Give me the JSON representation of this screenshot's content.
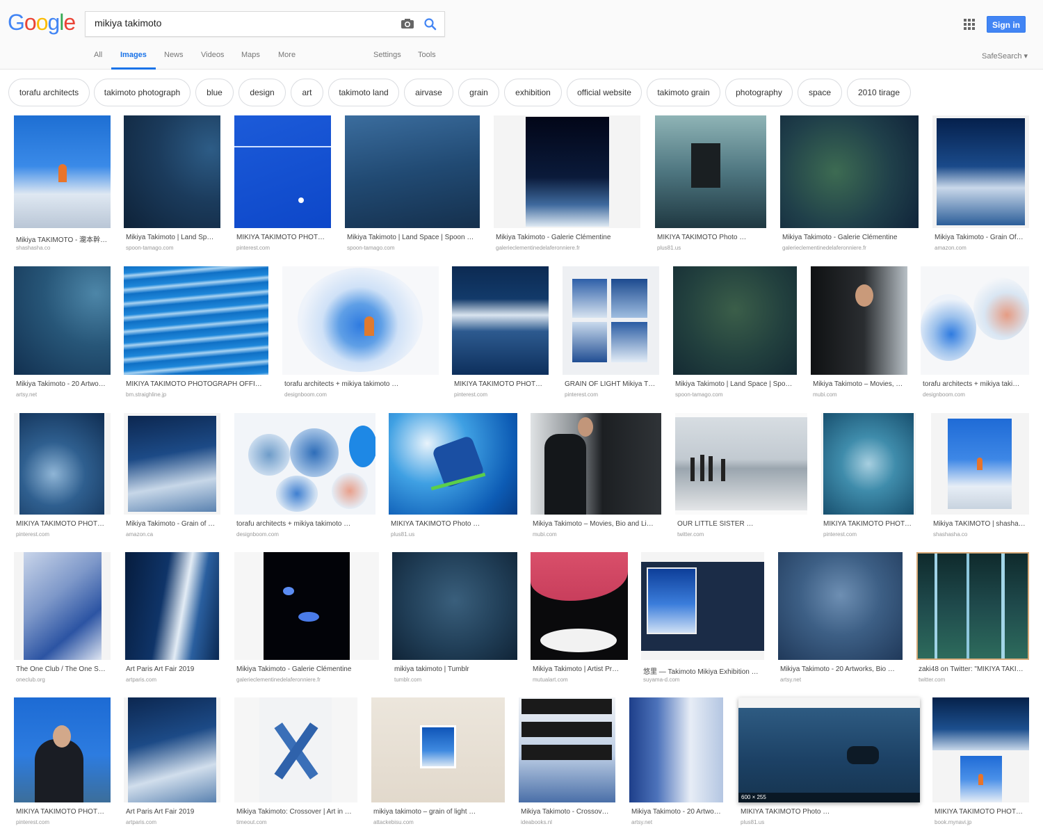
{
  "header": {
    "logo": [
      "G",
      "o",
      "o",
      "g",
      "l",
      "e"
    ],
    "logo_colors": [
      "#4285f4",
      "#ea4335",
      "#fbbc05",
      "#4285f4",
      "#34a853",
      "#ea4335"
    ],
    "search_query": "mikiya takimoto",
    "signin_label": "Sign in"
  },
  "nav": {
    "tabs": [
      "All",
      "Images",
      "News",
      "Videos",
      "Maps",
      "More"
    ],
    "active_tab": "Images",
    "settings_label": "Settings",
    "tools_label": "Tools",
    "safesearch_label": "SafeSearch ▾"
  },
  "chips": [
    "torafu architects",
    "takimoto photograph",
    "blue",
    "design",
    "art",
    "takimoto land",
    "airvase",
    "grain",
    "exhibition",
    "official website",
    "takimoto grain",
    "photography",
    "space",
    "2010 tirage"
  ],
  "results": [
    {
      "caption": "Mikiya TAKIMOTO - 瀧本幹…",
      "source": "shashasha.co"
    },
    {
      "caption": "Mikiya Takimoto | Land Sp…",
      "source": "spoon-tamago.com"
    },
    {
      "caption": "MIKIYA TAKIMOTO PHOT…",
      "source": "pinterest.com"
    },
    {
      "caption": "Mikiya Takimoto | Land Space | Spoon …",
      "source": "spoon-tamago.com"
    },
    {
      "caption": "Mikiya Takimoto - Galerie Clémentine",
      "source": "galerieclementinedelaferonniere.fr"
    },
    {
      "caption": "MIKIYA TAKIMOTO Photo …",
      "source": "plus81.us"
    },
    {
      "caption": "Mikiya Takimoto - Galerie Clémentine",
      "source": "galerieclementinedelaferonniere.fr"
    },
    {
      "caption": "Mikiya Takimoto - Grain Of…",
      "source": "amazon.com"
    },
    {
      "caption": "Mikiya Takimoto - 20 Artwo…",
      "source": "artsy.net"
    },
    {
      "caption": "MIKIYA TAKIMOTO PHOTOGRAPH OFFI…",
      "source": "bm.straighline.jp"
    },
    {
      "caption": "torafu architects + mikiya takimoto …",
      "source": "designboom.com"
    },
    {
      "caption": "MIKIYA TAKIMOTO PHOT…",
      "source": "pinterest.com"
    },
    {
      "caption": "GRAIN OF LIGHT Mikiya T…",
      "source": "pinterest.com"
    },
    {
      "caption": "Mikiya Takimoto | Land Space | Spo…",
      "source": "spoon-tamago.com"
    },
    {
      "caption": "Mikiya Takimoto – Movies, …",
      "source": "mubi.com"
    },
    {
      "caption": "torafu architects + mikiya taki…",
      "source": "designboom.com"
    },
    {
      "caption": "MIKIYA TAKIMOTO PHOT…",
      "source": "pinterest.com"
    },
    {
      "caption": "Mikiya Takimoto - Grain of …",
      "source": "amazon.ca"
    },
    {
      "caption": "torafu architects + mikiya takimoto …",
      "source": "designboom.com"
    },
    {
      "caption": "MIKIYA TAKIMOTO Photo …",
      "source": "plus81.us"
    },
    {
      "caption": "Mikiya Takimoto – Movies, Bio and Li…",
      "source": "mubi.com"
    },
    {
      "caption": "OUR LITTLE SISTER …",
      "source": "twitter.com"
    },
    {
      "caption": "MIKIYA TAKIMOTO PHOT…",
      "source": "pinterest.com"
    },
    {
      "caption": "Mikiya TAKIMOTO | shasha…",
      "source": "shashasha.co"
    },
    {
      "caption": "The One Club / The One S…",
      "source": "oneclub.org"
    },
    {
      "caption": "Art Paris Art Fair 2019",
      "source": "artparis.com"
    },
    {
      "caption": "Mikiya Takimoto - Galerie Clémentine",
      "source": "galerieclementinedelaferonniere.fr"
    },
    {
      "caption": "mikiya takimoto | Tumblr",
      "source": "tumblr.com"
    },
    {
      "caption": "Mikiya Takimoto | Artist Pr…",
      "source": "mutualart.com"
    },
    {
      "caption": "悠里 — Takimoto Mikiya Exhibition …",
      "source": "suyama-d.com"
    },
    {
      "caption": "Mikiya Takimoto - 20 Artworks, Bio …",
      "source": "artsy.net"
    },
    {
      "caption": "zaki48 on Twitter: \"MIKIYA TAKI…",
      "source": "twitter.com"
    },
    {
      "caption": "MIKIYA TAKIMOTO PHOT…",
      "source": "pinterest.com"
    },
    {
      "caption": "Art Paris Art Fair 2019",
      "source": "artparis.com"
    },
    {
      "caption": "Mikiya Takimoto: Crossover | Art in …",
      "source": "timeout.com"
    },
    {
      "caption": "mikiya takimoto – grain of light …",
      "source": "attackebisu.com"
    },
    {
      "caption": "Mikiya Takimoto - Crossov…",
      "source": "ideabooks.nl"
    },
    {
      "caption": "Mikiya Takimoto - 20 Artwo…",
      "source": "artsy.net"
    },
    {
      "caption": "MIKIYA TAKIMOTO Photo …",
      "source": "plus81.us"
    },
    {
      "caption": "MIKIYA TAKIMOTO PHOT…",
      "source": "book.mynavi.jp"
    }
  ],
  "hover_dimension": "600 × 255",
  "colors": {
    "accent": "#1a73e8",
    "signin": "#4285f4"
  }
}
